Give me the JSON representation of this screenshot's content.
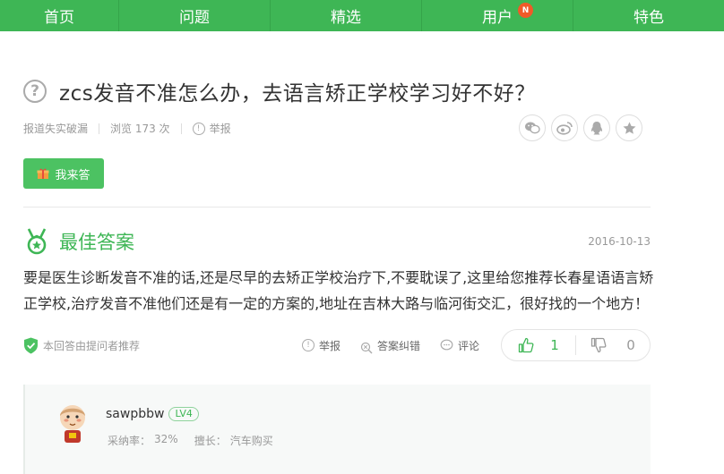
{
  "nav": {
    "items": [
      {
        "label": "首页"
      },
      {
        "label": "问题"
      },
      {
        "label": "精选"
      },
      {
        "label": "用户",
        "badge": "N"
      },
      {
        "label": "特色"
      }
    ]
  },
  "question": {
    "icon": "question-mark-icon",
    "title": "zcs发音不准怎么办，去语言矫正学校学习好不好？",
    "asker": "报道失实破漏",
    "views": "浏览 173 次",
    "report": "举报",
    "share_icons": [
      "wechat-icon",
      "weibo-icon",
      "qq-icon",
      "favorite-icon"
    ]
  },
  "answer_button": {
    "label": "我来答"
  },
  "best_answer": {
    "heading": "最佳答案",
    "date": "2016-10-13",
    "text": "要是医生诊断发音不准的话,还是尽早的去矫正学校治疗下,不要耽误了,这里给您推荐长春星语语言矫正学校,治疗发音不准他们还是有一定的方案的,地址在吉林大路与临河街交汇，很好找的一个地方！",
    "recommend": "本回答由提问者推荐",
    "report": "举报",
    "correct": "答案纠错",
    "comment": "评论",
    "upvotes": "1",
    "downvotes": "0",
    "accent": "#3eb655"
  },
  "answerer": {
    "name": "sawpbbw",
    "level": "LV4",
    "adoption_label": "采纳率：",
    "adoption_value": "32%",
    "skill_label": "擅长：",
    "skill_value": "汽车购买"
  }
}
